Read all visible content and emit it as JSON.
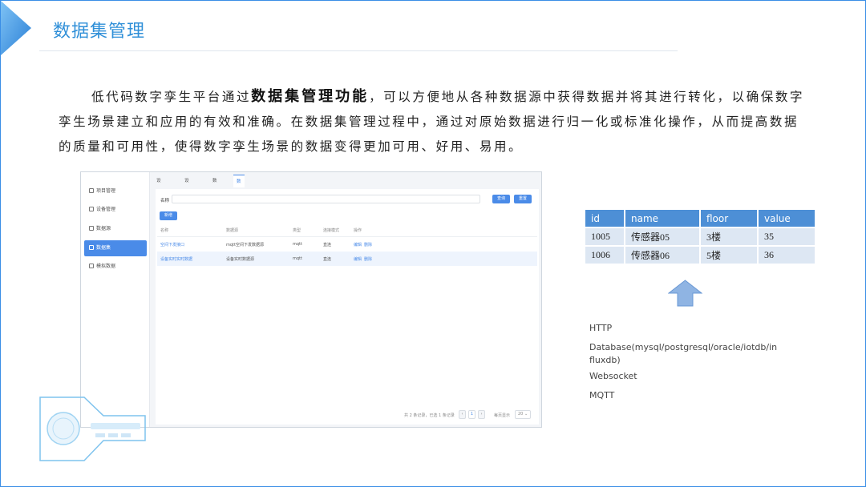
{
  "slide": {
    "title": "数据集管理",
    "paragraph": {
      "lead": "低代码数字孪生平台通过",
      "bold": "数据集管理功能",
      "rest": "，可以方便地从各种数据源中获得数据并将其进行转化，以确保数字孪生场景建立和应用的有效和准确。在数据集管理过程中，通过对原始数据进行归一化或标准化操作，从而提高数据的质量和可用性，使得数字孪生场景的数据变得更加可用、好用、易用。"
    }
  },
  "app": {
    "sidebar": [
      {
        "label": "项目管理",
        "active": false
      },
      {
        "label": "设备管理",
        "active": false
      },
      {
        "label": "数据源",
        "active": false
      },
      {
        "label": "数据集",
        "active": true
      },
      {
        "label": "模拟数据",
        "active": false
      }
    ],
    "tabs": [
      {
        "label": "设备管理",
        "active": false
      },
      {
        "label": "设备管理",
        "active": false
      },
      {
        "label": "数据源",
        "active": false
      },
      {
        "label": "数据集",
        "active": true
      }
    ],
    "filter": {
      "name_label": "名称",
      "query_button": "查询",
      "reset_button": "重置"
    },
    "add_button": "新增",
    "columns": [
      "名称",
      "数据源",
      "类型",
      "连接模式",
      "操作"
    ],
    "rows": [
      {
        "name": "空间下发接口",
        "source": "mqtt空间下发数据源",
        "type": "mqtt",
        "mode": "直连",
        "edit": "编辑",
        "del": "删除"
      },
      {
        "name": "设备实时实时数据",
        "source": "设备实时数据源",
        "type": "mqtt",
        "mode": "直连",
        "edit": "编辑",
        "del": "删除"
      }
    ],
    "pager": {
      "summary": "共 2 条记录，已选 1 条记录",
      "page": "1",
      "page_size_label": "每页显示",
      "page_size": "20"
    }
  },
  "data_table": {
    "headers": [
      "id",
      "name",
      "floor",
      "value"
    ],
    "rows": [
      [
        "1005",
        "传感器05",
        "3楼",
        "35"
      ],
      [
        "1006",
        "传感器06",
        "5楼",
        "36"
      ]
    ]
  },
  "protocols": [
    "HTTP",
    "Database(mysql/postgresql/oracle/iotdb/in",
    "fluxdb)",
    "Websocket",
    "MQTT"
  ],
  "colors": {
    "accent": "#2f8fd8",
    "table_header": "#4d8fd6",
    "table_cell": "#dde7f3",
    "arrow": "#8fb4e3"
  }
}
